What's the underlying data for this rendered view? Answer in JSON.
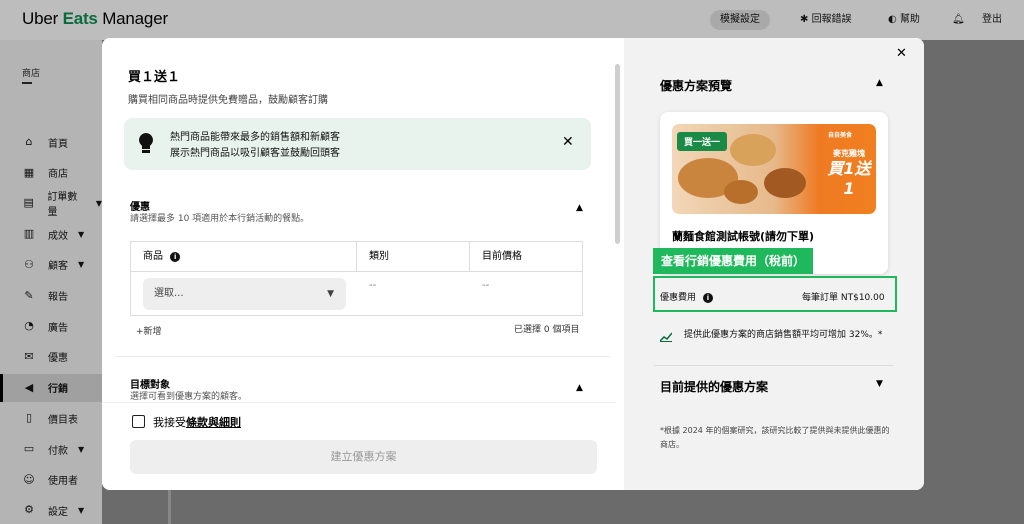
{
  "topbar": {
    "logo_uber": "Uber ",
    "logo_eats": "Eats",
    "logo_manager": " Manager",
    "mode_button": "模擬設定",
    "report_bug": "回報錯誤",
    "help": "幫助",
    "logout": "登出"
  },
  "sidebar": {
    "store_label": "商店",
    "items": [
      {
        "label": "首頁",
        "icon": "home-icon"
      },
      {
        "label": "商店",
        "icon": "store-icon"
      },
      {
        "label": "訂單數量",
        "icon": "orders-icon",
        "has_chevron": true
      },
      {
        "label": "成效",
        "icon": "performance-icon",
        "has_chevron": true
      },
      {
        "label": "顧客",
        "icon": "customers-icon",
        "has_chevron": true
      },
      {
        "label": "報告",
        "icon": "reports-icon"
      },
      {
        "label": "廣告",
        "icon": "ads-icon"
      },
      {
        "label": "優惠",
        "icon": "offers-icon"
      },
      {
        "label": "行銷",
        "icon": "marketing-icon",
        "active": true
      },
      {
        "label": "價目表",
        "icon": "menu-icon"
      },
      {
        "label": "付款",
        "icon": "payments-icon",
        "has_chevron": true
      },
      {
        "label": "使用者",
        "icon": "users-icon"
      },
      {
        "label": "設定",
        "icon": "settings-icon",
        "has_chevron": true
      }
    ]
  },
  "modal": {
    "title": "買１送１",
    "subtitle": "購買相同商品時提供免費贈品，鼓勵顧客訂購",
    "tip": {
      "line1": "熱門商品能帶來最多的銷售額和新顧客",
      "line2": "展示熱門商品以吸引顧客並鼓勵回頭客"
    },
    "offer_section": {
      "title": "優惠",
      "desc": "請選擇最多 10 項適用於本行銷活動的餐點。"
    },
    "table": {
      "headers": [
        "商品",
        "類別",
        "目前價格"
      ],
      "select_placeholder": "選取...",
      "category_value": "--",
      "price_value": "--"
    },
    "add_new": "+新增",
    "selected_count": "已選擇 0 個項目",
    "target_section": {
      "title": "目標對象",
      "desc": "選擇可看到優惠方案的顧客。"
    },
    "terms_prefix": "我接受",
    "terms_link": "條款與細則",
    "create_button": "建立優惠方案"
  },
  "preview": {
    "title": "優惠方案預覽",
    "badge": "買一送一",
    "promo_brand": "自自美食",
    "promo_line1": "麥克雞塊",
    "promo_line2": "買1送1",
    "store_name": "蘭麵食館測試帳號(請勿下單)",
    "callout": "查看行銷優惠費用（稅前）",
    "fee_label": "優惠費用",
    "fee_value": "每筆訂單 NT$10.00",
    "trend_text": "提供此優惠方案的商店銷售額平均可增加 32%。*",
    "current_title": "目前提供的優惠方案",
    "footnote": "*根據 2024 年的個案研究，該研究比較了提供與未提供此優惠的商店。"
  },
  "colors": {
    "brand_green": "#06c167",
    "callout_green": "#1fb85c",
    "tip_bg": "#e8f3ee",
    "overlay_gray": "#6b6b6b"
  }
}
